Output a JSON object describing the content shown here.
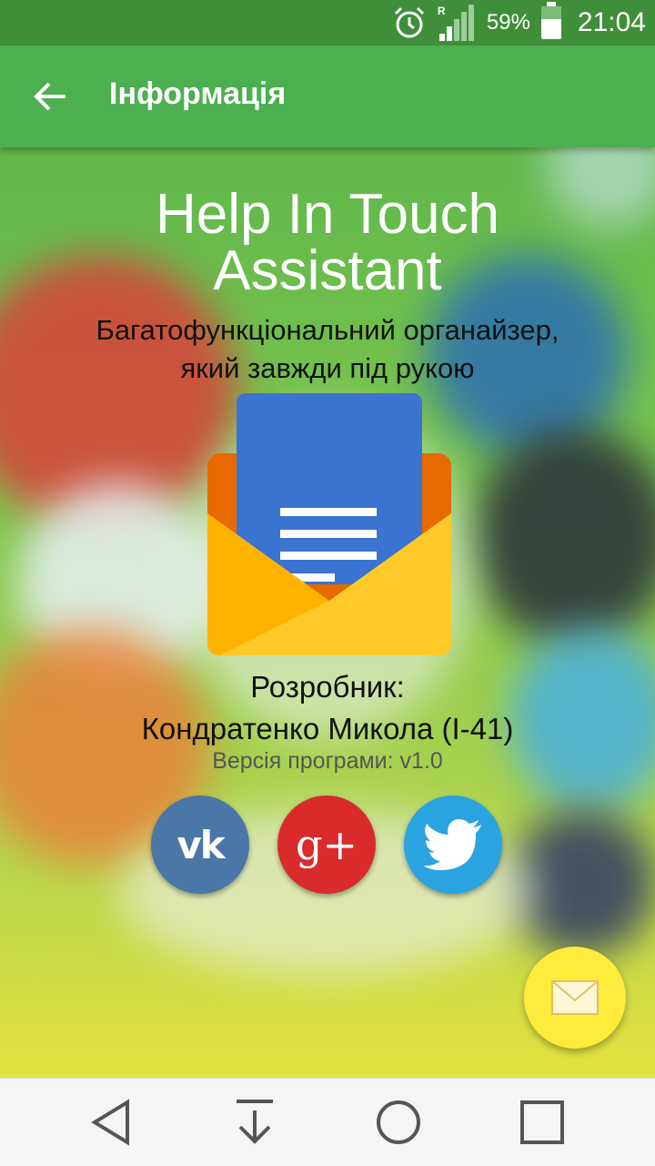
{
  "status_bar": {
    "battery_percent": "59%",
    "time": "21:04",
    "signal_letter": "R",
    "icons": [
      "alarm-icon",
      "signal-icon",
      "battery-icon"
    ]
  },
  "toolbar": {
    "title": "Інформація",
    "back_icon": "arrow-back-icon"
  },
  "main": {
    "app_title_line1": "Help In Touch",
    "app_title_line2": "Assistant",
    "subtitle_line1": "Багатофункціональний органайзер,",
    "subtitle_line2": "який завжди під рукою",
    "developer_label": "Розробник:",
    "developer_name": "Кондратенко Микола (І-41)",
    "version": "Версія програми: v1.0"
  },
  "social": {
    "buttons": [
      {
        "icon": "vk-icon",
        "text": "vk",
        "color": "#4a76a8"
      },
      {
        "icon": "google-plus-icon",
        "text": "g+",
        "color": "#d92b2b"
      },
      {
        "icon": "twitter-icon",
        "color": "#2aa3e0"
      }
    ]
  },
  "fab": {
    "icon": "mail-icon",
    "color": "#ffeb3b"
  },
  "nav_bar": {
    "icons": [
      "nav-back-icon",
      "nav-down-icon",
      "nav-home-icon",
      "nav-recents-icon"
    ]
  },
  "colors": {
    "toolbar": "#4caf50",
    "status_bar": "#3f8f3a"
  }
}
